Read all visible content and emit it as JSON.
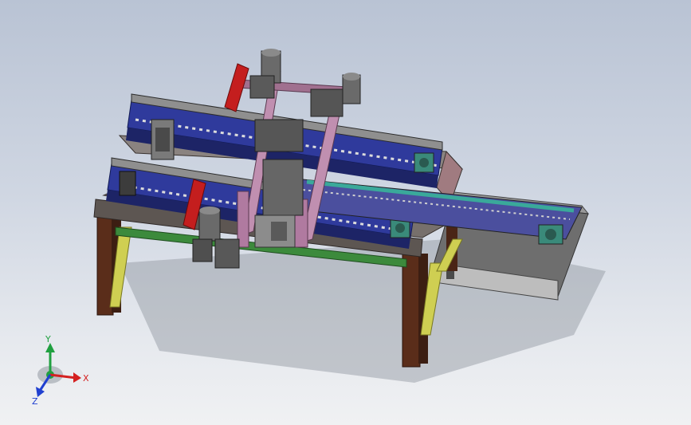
{
  "viewport": {
    "background_top": "#b9c3d4",
    "background_bottom": "#f0f1f3"
  },
  "model": {
    "colors": {
      "frame_top": "#77706c",
      "frame_edge": "#4a4340",
      "leg": "#5a2d1a",
      "leg_dark": "#3c1e12",
      "brace": "#cfcf52",
      "conveyor_blue": "#2f3a9c",
      "conveyor_dark": "#1d2466",
      "chain": "#8f8f8f",
      "chain_dark": "#2c2c2c",
      "gantry_pink": "#c08fb0",
      "cylinder_red": "#c41e1e",
      "motor_gray": "#6a6a6a",
      "teal_part": "#3aa99a",
      "green_strip": "#3c8a3c",
      "shadow": "#8e949e"
    }
  },
  "triad": {
    "x_label": "X",
    "y_label": "Y",
    "z_label": "Z",
    "x_color": "#d42020",
    "y_color": "#20a040",
    "z_color": "#2040d0"
  }
}
